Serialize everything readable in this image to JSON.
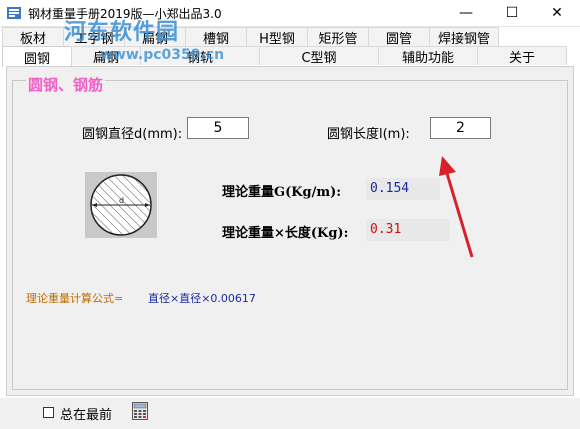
{
  "window": {
    "title": "钢材重量手册2019版—小郑出品3.0",
    "minimize": "—",
    "maximize": "☐",
    "close": "✕"
  },
  "watermark": {
    "name": "河东软件园",
    "url": "www.pc0359.cn"
  },
  "tabs": {
    "row1": [
      {
        "label": "板材",
        "width": 62
      },
      {
        "label": "工字钢",
        "width": 62
      },
      {
        "label": "扁钢",
        "width": 62
      },
      {
        "label": "槽钢",
        "width": 62
      },
      {
        "label": "H型钢",
        "width": 62
      },
      {
        "label": "矩形管",
        "width": 62
      },
      {
        "label": "圆管",
        "width": 62
      },
      {
        "label": "焊接钢管",
        "width": 70
      }
    ],
    "row2": [
      {
        "label": "圆钢",
        "width": 70,
        "active": true
      },
      {
        "label": "扁钢",
        "width": 70
      },
      {
        "label": "钢轨",
        "width": 120
      },
      {
        "label": "C型钢",
        "width": 120
      },
      {
        "label": "辅助功能",
        "width": 100
      },
      {
        "label": "关于",
        "width": 90
      }
    ]
  },
  "group": {
    "title": "圆钢、钢筋"
  },
  "inputs": {
    "diameter_label": "圆钢直径d(mm):",
    "diameter_value": "5",
    "length_label": "圆钢长度l(m):",
    "length_value": "2"
  },
  "results": {
    "unit_weight_label": "理论重量G(Kg/m):",
    "unit_weight_value": "0.154",
    "total_weight_label": "理论重量×长度(Kg):",
    "total_weight_value": "0.31"
  },
  "formula": {
    "label": "理论重量计算公式=",
    "text": "直径×直径×0.00617"
  },
  "bottom": {
    "always_on_top_label": "总在最前"
  },
  "colors": {
    "group_title": "#f062c8",
    "unit_weight_value": "#1a2aa0",
    "total_weight_value": "#d01010",
    "formula_label": "#c06a00",
    "formula_text": "#1a2aa0",
    "arrow": "#d8202a"
  }
}
